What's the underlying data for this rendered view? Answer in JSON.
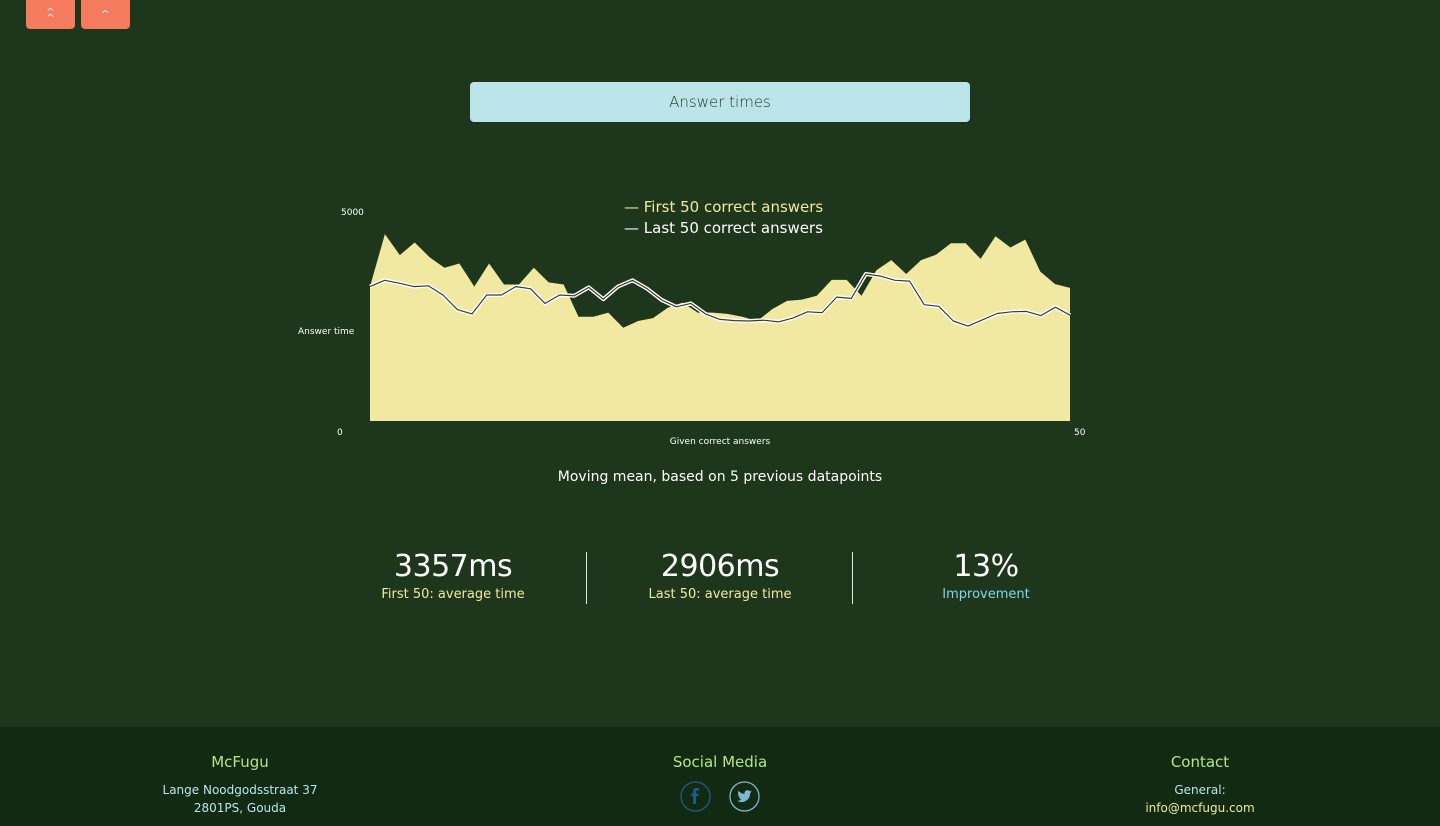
{
  "nav": {
    "top_label": "^",
    "up_label": "^",
    "color": "#f47b5e"
  },
  "header": {
    "title": "Answer times",
    "bg_color": "#bce5ea"
  },
  "chart_data": {
    "type": "area",
    "title": "",
    "legend": [
      "— First 50 correct answers",
      "— Last 50 correct answers"
    ],
    "legend_position": "top-center",
    "ylabel": "Answer time",
    "xlabel": "Given correct answers",
    "y_tick_labels": [
      "0",
      "5000"
    ],
    "x_tick_labels": [
      "50"
    ],
    "ylim": [
      0,
      5000
    ],
    "xlim": [
      0,
      50
    ],
    "x": [
      0,
      1,
      2,
      3,
      4,
      5,
      6,
      7,
      8,
      9,
      10,
      11,
      12,
      13,
      14,
      15,
      16,
      17,
      18,
      19,
      20,
      21,
      22,
      23,
      24,
      25,
      26,
      27,
      28,
      29,
      30,
      31,
      32,
      33,
      34,
      35,
      36,
      37,
      38,
      39,
      40,
      41,
      42,
      43,
      44,
      45,
      46,
      47,
      48,
      49,
      50
    ],
    "series": [
      {
        "name": "First 50 correct answers",
        "color": "#f1e9a2",
        "render": "area",
        "values": [
          3200,
          4450,
          3950,
          4250,
          3900,
          3650,
          3750,
          3200,
          3750,
          3250,
          3250,
          3650,
          3300,
          3250,
          2480,
          2480,
          2580,
          2220,
          2380,
          2450,
          2700,
          2820,
          2580,
          2580,
          2550,
          2480,
          2380,
          2660,
          2860,
          2890,
          2980,
          3360,
          3360,
          2980,
          3590,
          3830,
          3500,
          3830,
          3960,
          4230,
          4230,
          3860,
          4400,
          4130,
          4320,
          3560,
          3260,
          3170
        ]
      },
      {
        "name": "Last 50 correct answers",
        "color": "#ffffff",
        "render": "line",
        "values": [
          3200,
          3350,
          3280,
          3200,
          3220,
          3000,
          2650,
          2550,
          3000,
          3000,
          3200,
          3150,
          2800,
          3000,
          2980,
          3180,
          2900,
          3200,
          3350,
          3150,
          2880,
          2720,
          2800,
          2550,
          2420,
          2390,
          2380,
          2400,
          2360,
          2450,
          2600,
          2580,
          2950,
          2920,
          3500,
          3450,
          3350,
          3330,
          2770,
          2730,
          2380,
          2260,
          2410,
          2560,
          2600,
          2610,
          2510,
          2710,
          2520
        ]
      }
    ]
  },
  "chart_caption": "Moving mean, based on 5 previous datapoints",
  "stats": [
    {
      "value": "3357ms",
      "label": "First 50: average time",
      "label_color": "#f1e9a2"
    },
    {
      "value": "2906ms",
      "label": "Last 50: average time",
      "label_color": "#f1e9a2"
    },
    {
      "value": "13%",
      "label": "Improvement",
      "label_color": "#84d4ec"
    }
  ],
  "footer": {
    "company": {
      "heading": "McFugu",
      "address_line1": "Lange Noodgodsstraat 37",
      "address_line2": "2801PS, Gouda"
    },
    "social": {
      "heading": "Social Media",
      "icons": [
        "facebook-icon",
        "twitter-icon"
      ],
      "facebook_color": "#1f5a8c",
      "twitter_color": "#7fb7cf"
    },
    "contact": {
      "heading": "Contact",
      "label": "General:",
      "email": "info@mcfugu.com"
    }
  }
}
